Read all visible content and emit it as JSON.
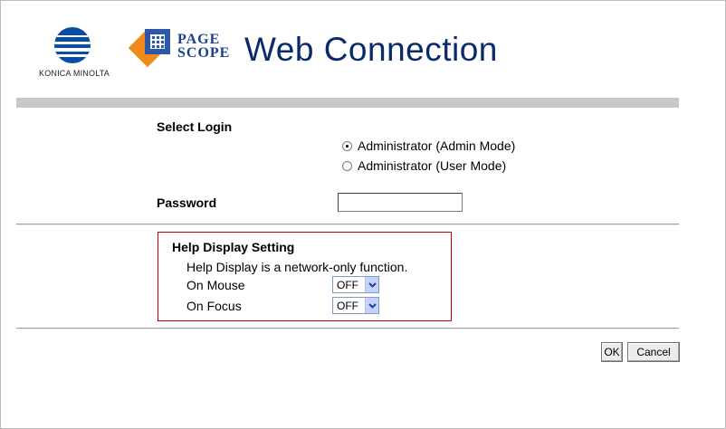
{
  "header": {
    "brand_text": "KONICA MINOLTA",
    "product_logo_text_line1": "PAGE",
    "product_logo_text_line2": "SCOPE",
    "app_title": "Web Connection"
  },
  "login": {
    "heading": "Select Login",
    "options": [
      {
        "label": "Administrator (Admin Mode)",
        "checked": true
      },
      {
        "label": "Administrator (User Mode)",
        "checked": false
      }
    ],
    "password_label": "Password",
    "password_value": ""
  },
  "help": {
    "title": "Help Display Setting",
    "description": "Help Display is a network-only function.",
    "on_mouse_label": "On Mouse",
    "on_mouse_value": "OFF",
    "on_focus_label": "On Focus",
    "on_focus_value": "OFF"
  },
  "buttons": {
    "ok_label": "OK",
    "cancel_label": "Cancel"
  },
  "colors": {
    "brand_blue": "#0a4da8",
    "title_navy": "#0b2a6b",
    "pagescope_orange": "#f08a1c",
    "help_border": "#c00000",
    "bar_gray": "#c8c8c8"
  },
  "icons": [
    "konica-minolta-globe-icon",
    "pagescope-logo-icon",
    "chevron-down-icon"
  ]
}
